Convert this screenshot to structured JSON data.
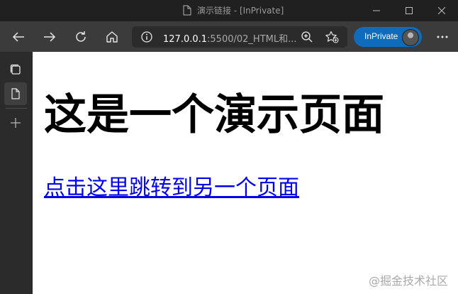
{
  "window": {
    "title": "演示链接 - [InPrivate]"
  },
  "toolbar": {
    "address_host": "127.0.0.1",
    "address_path": ":5500/02_HTML和...",
    "inprivate_label": "InPrivate"
  },
  "page": {
    "heading": "这是一个演示页面",
    "link_text": "点击这里跳转到另一个页面"
  },
  "watermark": "@掘金技术社区",
  "colors": {
    "titlebar_bg": "#202020",
    "toolbar_bg": "#3b3b3b",
    "sidebar_bg": "#2b2b2b",
    "inprivate_accent": "#0f6cbd",
    "link_color": "#0000ee"
  }
}
